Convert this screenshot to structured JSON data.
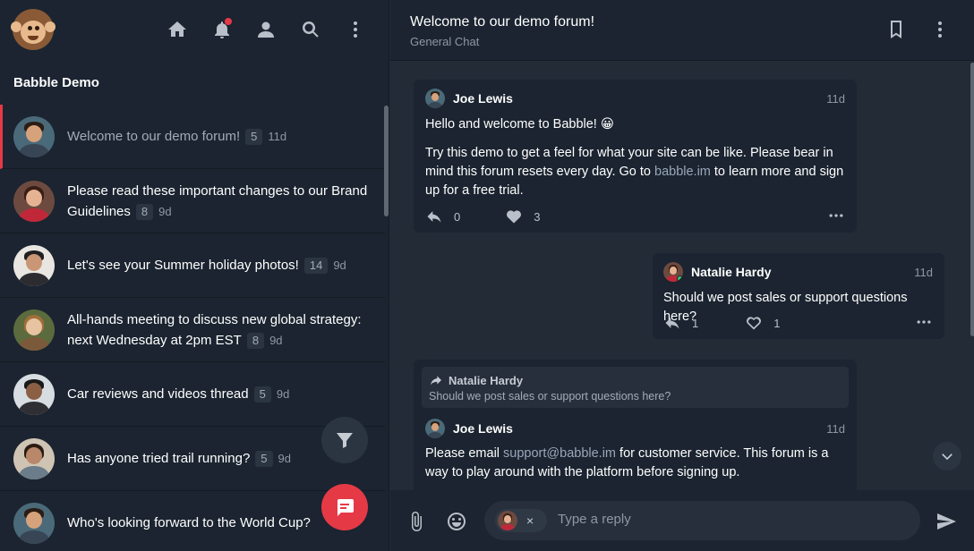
{
  "sidebar": {
    "title": "Babble Demo",
    "icons": [
      "home-icon",
      "bell-icon",
      "user-icon",
      "search-icon",
      "more-vertical-icon"
    ],
    "topics": [
      {
        "title": "Welcome to our demo forum!",
        "count": "5",
        "age": "11d",
        "active": true
      },
      {
        "title": "Please read these important changes to our Brand Guidelines",
        "count": "8",
        "age": "9d"
      },
      {
        "title": "Let's see your Summer holiday photos!",
        "count": "14",
        "age": "9d"
      },
      {
        "title": "All-hands meeting to discuss new global strategy: next Wednesday at 2pm EST",
        "count": "8",
        "age": "9d"
      },
      {
        "title": "Car reviews and videos thread",
        "count": "5",
        "age": "9d"
      },
      {
        "title": "Has anyone tried trail running?",
        "count": "5",
        "age": "9d"
      },
      {
        "title": "Who's looking forward to the World Cup?",
        "count": "",
        "age": ""
      }
    ]
  },
  "header": {
    "title": "Welcome to our demo forum!",
    "subtitle": "General Chat"
  },
  "messages": [
    {
      "author": "Joe Lewis",
      "time": "11d",
      "greeting": "Hello and welcome to Babble! 😀",
      "para_before_link": "Try this demo to get a feel for what your site can be like. Please bear in mind this forum resets every day. Go to ",
      "link": "babble.im",
      "para_after_link": " to learn more and sign up for a free trial.",
      "replies": "0",
      "likes": "3"
    },
    {
      "author": "Natalie Hardy",
      "time": "11d",
      "text": "Should we post sales or support questions here?",
      "replies": "1",
      "likes": "1"
    },
    {
      "quote_author": "Natalie Hardy",
      "quote_text": "Should we post sales or support questions here?",
      "author": "Joe Lewis",
      "time": "11d",
      "text_before_link": "Please email ",
      "link": "support@babble.im",
      "text_after_link": " for customer service. This forum is a way to play around with the platform before signing up."
    }
  ],
  "composer": {
    "chip_close": "×",
    "placeholder": "Type a reply"
  },
  "colors": {
    "accent": "#e63946",
    "panel": "#1b2430",
    "background": "#222b36",
    "online": "#2ecc71"
  }
}
